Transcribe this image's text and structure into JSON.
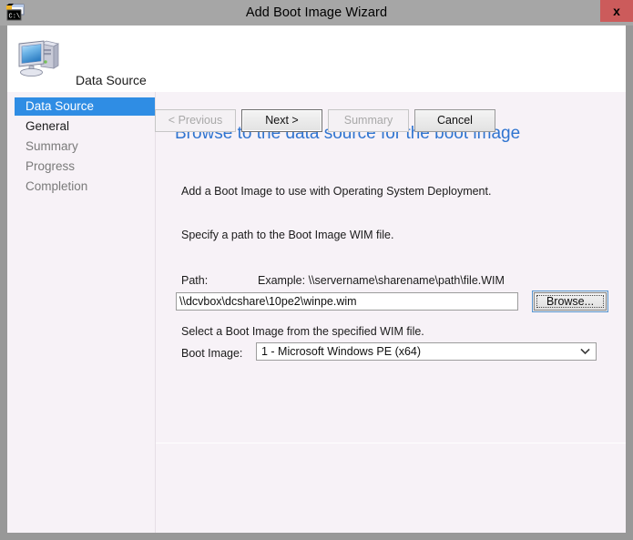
{
  "window": {
    "title": "Add Boot Image Wizard",
    "titlebar_icon": "wim-file-icon",
    "close_label": "x",
    "titlebar_color": "#a6a6a6",
    "close_color": "#cc5b5b",
    "body_color": "#f7f2f7"
  },
  "banner": {
    "icon": "computer-icon",
    "title": "Data Source"
  },
  "sidebar": {
    "items": [
      {
        "label": "Data Source",
        "state": "selected"
      },
      {
        "label": "General",
        "state": "active"
      },
      {
        "label": "Summary",
        "state": "inactive"
      },
      {
        "label": "Progress",
        "state": "inactive"
      },
      {
        "label": "Completion",
        "state": "inactive"
      }
    ],
    "selected_color": "#2f8de4"
  },
  "content": {
    "heading": "Browse to the data source for the boot image",
    "heading_color": "#2f74d0",
    "paragraph_1": "Add a Boot Image to use with Operating System Deployment.",
    "paragraph_2": "Specify a path to the Boot Image WIM file.",
    "path_label": "Path:",
    "path_example": "Example: \\\\servername\\sharename\\path\\file.WIM",
    "path_value": "\\\\dcvbox\\dcshare\\10pe2\\winpe.wim",
    "path_placeholder": "",
    "browse_label": "Browse...",
    "select_hint": "Select a Boot Image from the specified WIM file.",
    "boot_image_label": "Boot Image:",
    "boot_image_selected": "1 - Microsoft Windows PE (x64)",
    "boot_image_options": [
      "1 - Microsoft Windows PE (x64)"
    ]
  },
  "footer": {
    "previous_label": "< Previous",
    "next_label": "Next >",
    "summary_label": "Summary",
    "cancel_label": "Cancel"
  }
}
